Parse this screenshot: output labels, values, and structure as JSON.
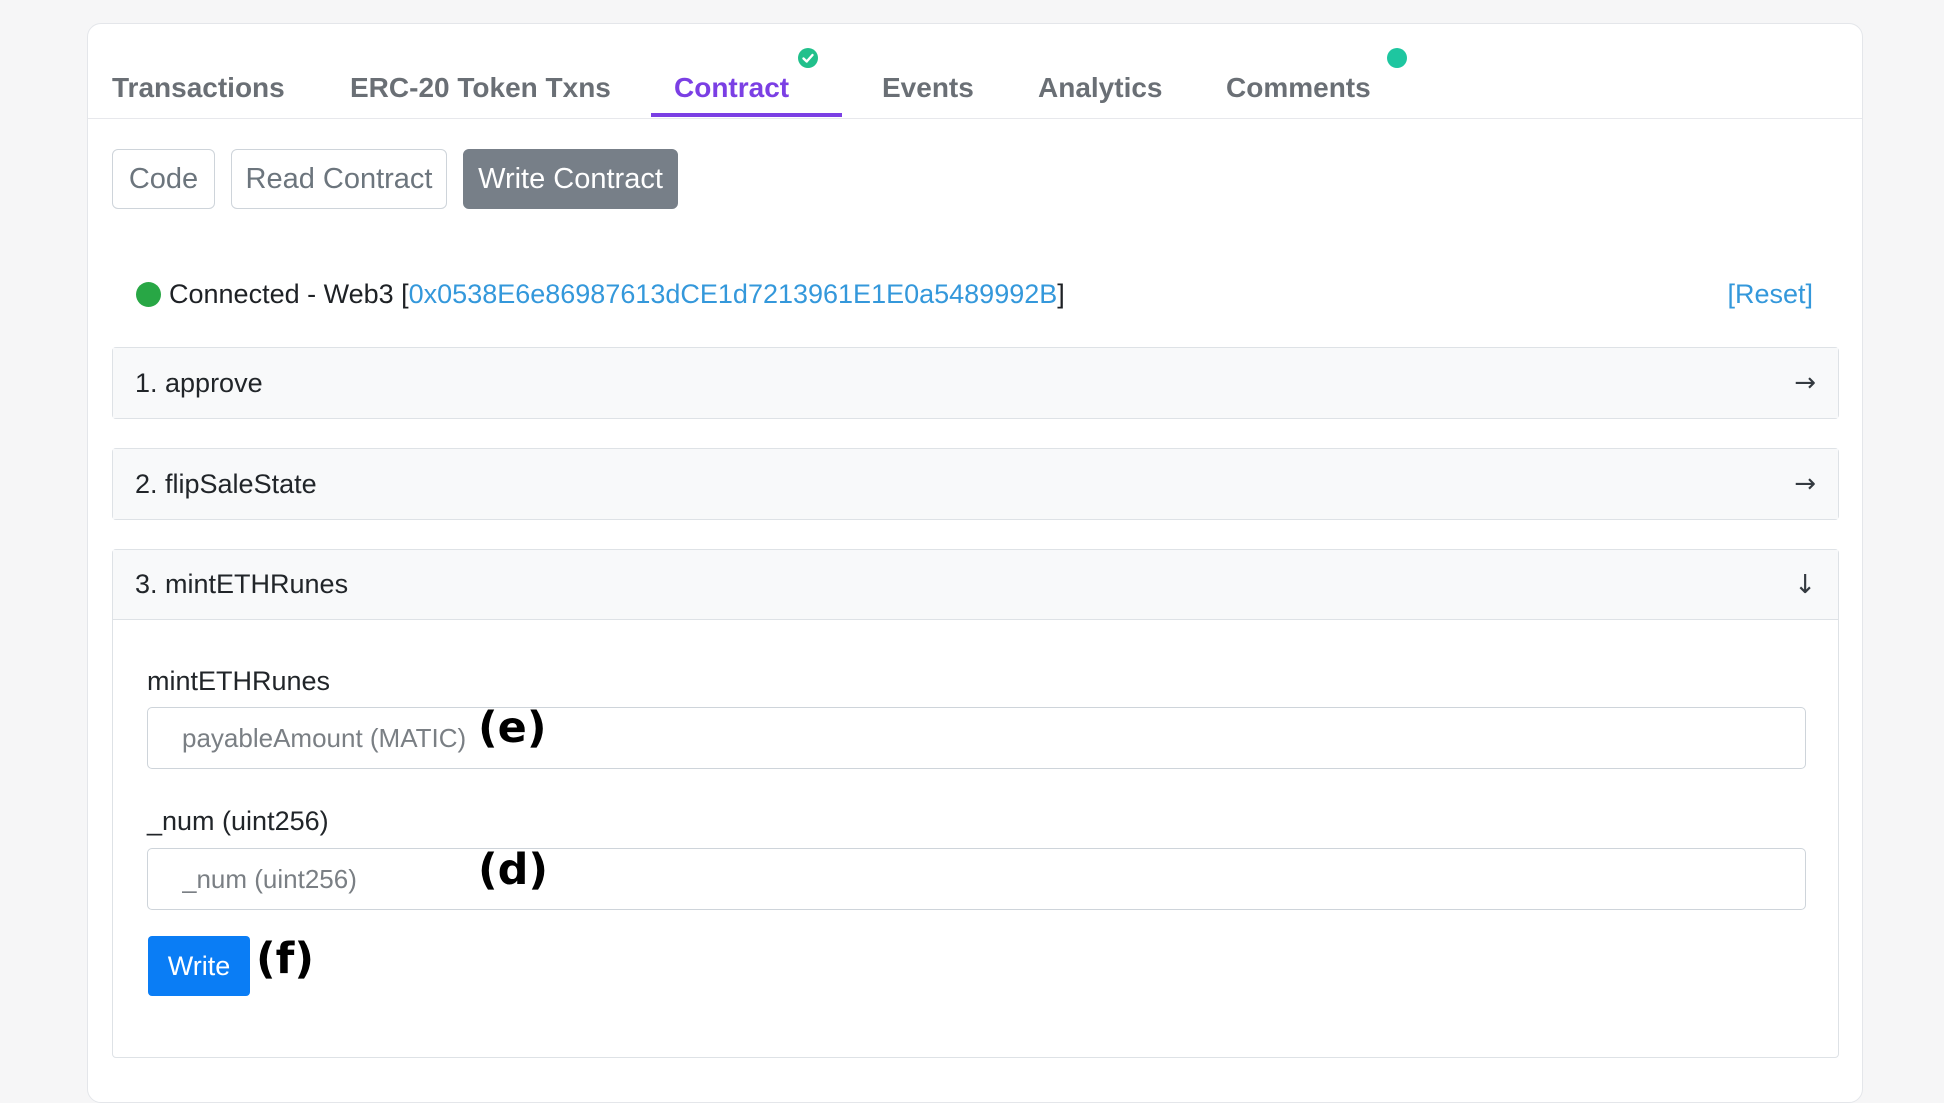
{
  "tabs": [
    {
      "label": "Transactions",
      "active": false
    },
    {
      "label": "ERC-20 Token Txns",
      "active": false
    },
    {
      "label": "Contract",
      "active": true,
      "badge": "check-icon"
    },
    {
      "label": "Events",
      "active": false
    },
    {
      "label": "Analytics",
      "active": false
    },
    {
      "label": "Comments",
      "active": false,
      "badge": "dot-icon"
    }
  ],
  "subtabs": [
    {
      "label": "Code",
      "active": false
    },
    {
      "label": "Read Contract",
      "active": false
    },
    {
      "label": "Write Contract",
      "active": true
    }
  ],
  "status": {
    "prefix": "Connected - Web3 [",
    "address": "0x0538E6e86987613dCE1d7213961E1E0a5489992B",
    "suffix": "]",
    "reset_label": "[Reset]",
    "color": "#28a745"
  },
  "functions": [
    {
      "label": "1. approve",
      "expanded": false,
      "icon": "arrow-right-icon"
    },
    {
      "label": "2. flipSaleState",
      "expanded": false,
      "icon": "arrow-right-icon"
    },
    {
      "label": "3. mintETHRunes",
      "expanded": true,
      "icon": "arrow-down-icon"
    }
  ],
  "mint_form": {
    "title": "mintETHRunes",
    "payable_placeholder": "payableAmount (MATIC)",
    "num_label": "_num (uint256)",
    "num_placeholder": "_num (uint256)",
    "write_label": "Write"
  },
  "annotations": {
    "e": "(e)",
    "d": "(d)",
    "f": "(f)"
  },
  "colors": {
    "accent": "#7b3fe4",
    "link": "#3498db",
    "primary_button": "#0a7df5",
    "active_subtab": "#777f88"
  }
}
